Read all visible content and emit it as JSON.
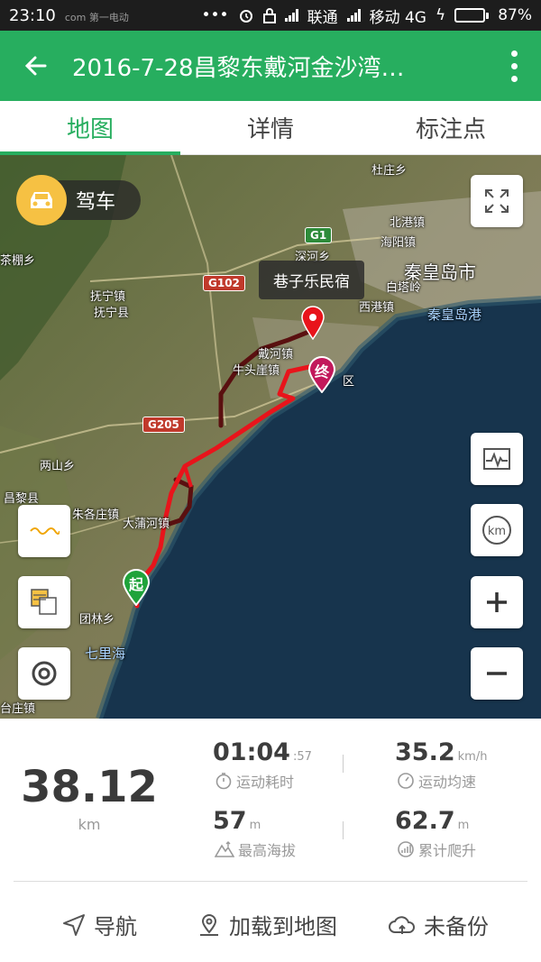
{
  "status": {
    "time": "23:10",
    "watermark": "com 第一电动",
    "carrier1": "联通",
    "carrier2": "移动 4G",
    "battery": "87%",
    "battery_level": 0.87
  },
  "appbar": {
    "title": "2016-7-28昌黎东戴河金沙湾…"
  },
  "tabs": [
    {
      "label": "地图",
      "active": true
    },
    {
      "label": "详情",
      "active": false
    },
    {
      "label": "标注点",
      "active": false
    }
  ],
  "map": {
    "mode_label": "驾车",
    "tooltip": "巷子乐民宿",
    "start_marker": "起",
    "end_marker": "终",
    "places": {
      "qinhuangdao_city": "秦皇岛市",
      "qinhuangdao_port": "秦皇岛港",
      "beigang": "北港镇",
      "haiyang": "海阳镇",
      "baitang": "白塔岭",
      "xigang": "西港镇",
      "duzhuang": "杜庄乡",
      "shenhe": "深河乡",
      "funing_town": "抚宁镇",
      "funing_county": "抚宁县",
      "tea_town": "茶棚乡",
      "daihe": "戴河镇",
      "niutouya": "牛头崖镇",
      "district": "区",
      "liangshan": "两山乡",
      "changli": "昌黎县",
      "quzhuang": "朱各庄镇",
      "dapu": "大蒲河镇",
      "tuanlin": "团林乡",
      "qili": "七里海",
      "taitou": "台庄镇"
    },
    "highways": {
      "g1": "G1",
      "g102": "G102",
      "g205": "G205"
    }
  },
  "stats": {
    "distance_value": "38.12",
    "distance_unit": "km",
    "duration_main": "01:04",
    "duration_sec": ":57",
    "duration_label": "运动耗时",
    "speed_value": "35.2",
    "speed_unit": "km/h",
    "speed_label": "运动均速",
    "altitude_value": "57",
    "altitude_unit": "m",
    "altitude_label": "最高海拔",
    "climb_value": "62.7",
    "climb_unit": "m",
    "climb_label": "累计爬升"
  },
  "actions": {
    "navigate": "导航",
    "load_to_map": "加载到地图",
    "backup": "未备份"
  },
  "colors": {
    "brand": "#27ae5f",
    "route": "#e8141b",
    "route_dark": "#5a1010",
    "start_marker": "#1fa33a",
    "end_marker": "#c2185b"
  }
}
